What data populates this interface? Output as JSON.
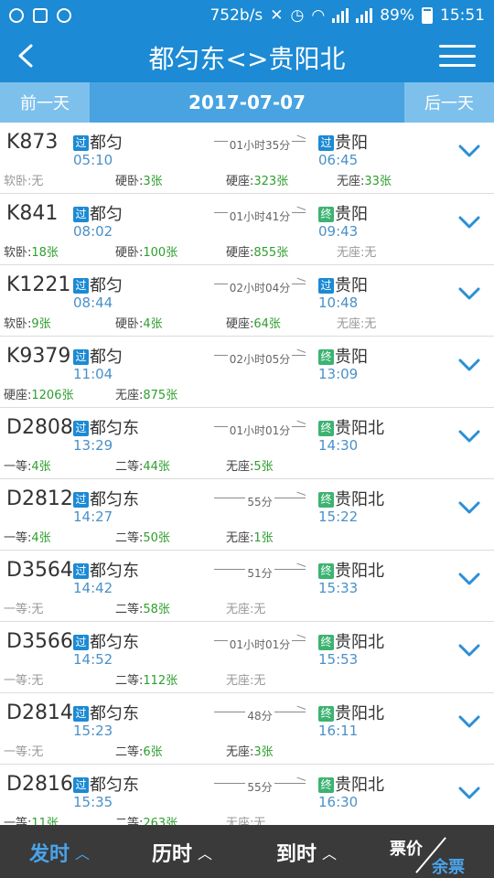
{
  "status_bar": {
    "network_speed": "752b/s",
    "battery": "89%",
    "time": "15:51"
  },
  "header": {
    "title": "都匀东<>贵阳北"
  },
  "date_bar": {
    "prev_label": "前一天",
    "date": "2017-07-07",
    "next_label": "后一天"
  },
  "trains": [
    {
      "no": "K873",
      "from_badge": "过",
      "from": "都匀",
      "depart": "05:10",
      "duration": "01小时35分",
      "to_badge": "过",
      "to": "贵阳",
      "arrive": "06:45",
      "seats": [
        {
          "label": "软卧:",
          "count": "无"
        },
        {
          "label": "硬卧:",
          "count": "3张"
        },
        {
          "label": "硬座:",
          "count": "323张"
        },
        {
          "label": "无座:",
          "count": "33张"
        }
      ]
    },
    {
      "no": "K841",
      "from_badge": "过",
      "from": "都匀",
      "depart": "08:02",
      "duration": "01小时41分",
      "to_badge": "终",
      "to": "贵阳",
      "arrive": "09:43",
      "seats": [
        {
          "label": "软卧:",
          "count": "18张"
        },
        {
          "label": "硬卧:",
          "count": "100张"
        },
        {
          "label": "硬座:",
          "count": "855张"
        },
        {
          "label": "无座:",
          "count": "无"
        }
      ]
    },
    {
      "no": "K1221",
      "from_badge": "过",
      "from": "都匀",
      "depart": "08:44",
      "duration": "02小时04分",
      "to_badge": "过",
      "to": "贵阳",
      "arrive": "10:48",
      "seats": [
        {
          "label": "软卧:",
          "count": "9张"
        },
        {
          "label": "硬卧:",
          "count": "4张"
        },
        {
          "label": "硬座:",
          "count": "64张"
        },
        {
          "label": "无座:",
          "count": "无"
        }
      ]
    },
    {
      "no": "K9379",
      "from_badge": "过",
      "from": "都匀",
      "depart": "11:04",
      "duration": "02小时05分",
      "to_badge": "终",
      "to": "贵阳",
      "arrive": "13:09",
      "seats": [
        {
          "label": "硬座:",
          "count": "1206张"
        },
        {
          "label": "无座:",
          "count": "875张"
        }
      ]
    },
    {
      "no": "D2808",
      "from_badge": "过",
      "from": "都匀东",
      "depart": "13:29",
      "duration": "01小时01分",
      "to_badge": "终",
      "to": "贵阳北",
      "arrive": "14:30",
      "seats": [
        {
          "label": "一等:",
          "count": "4张"
        },
        {
          "label": "二等:",
          "count": "44张"
        },
        {
          "label": "无座:",
          "count": "5张"
        }
      ]
    },
    {
      "no": "D2812",
      "from_badge": "过",
      "from": "都匀东",
      "depart": "14:27",
      "duration": "55分",
      "to_badge": "终",
      "to": "贵阳北",
      "arrive": "15:22",
      "seats": [
        {
          "label": "一等:",
          "count": "4张"
        },
        {
          "label": "二等:",
          "count": "50张"
        },
        {
          "label": "无座:",
          "count": "1张"
        }
      ]
    },
    {
      "no": "D3564",
      "from_badge": "过",
      "from": "都匀东",
      "depart": "14:42",
      "duration": "51分",
      "to_badge": "终",
      "to": "贵阳北",
      "arrive": "15:33",
      "seats": [
        {
          "label": "一等:",
          "count": "无"
        },
        {
          "label": "二等:",
          "count": "58张"
        },
        {
          "label": "无座:",
          "count": "无"
        }
      ]
    },
    {
      "no": "D3566",
      "from_badge": "过",
      "from": "都匀东",
      "depart": "14:52",
      "duration": "01小时01分",
      "to_badge": "终",
      "to": "贵阳北",
      "arrive": "15:53",
      "seats": [
        {
          "label": "一等:",
          "count": "无"
        },
        {
          "label": "二等:",
          "count": "112张"
        },
        {
          "label": "无座:",
          "count": "无"
        }
      ]
    },
    {
      "no": "D2814",
      "from_badge": "过",
      "from": "都匀东",
      "depart": "15:23",
      "duration": "48分",
      "to_badge": "终",
      "to": "贵阳北",
      "arrive": "16:11",
      "seats": [
        {
          "label": "一等:",
          "count": "无"
        },
        {
          "label": "二等:",
          "count": "6张"
        },
        {
          "label": "无座:",
          "count": "3张"
        }
      ]
    },
    {
      "no": "D2816",
      "from_badge": "过",
      "from": "都匀东",
      "depart": "15:35",
      "duration": "55分",
      "to_badge": "终",
      "to": "贵阳北",
      "arrive": "16:30",
      "seats": [
        {
          "label": "一等:",
          "count": "11张"
        },
        {
          "label": "二等:",
          "count": "263张"
        },
        {
          "label": "无座:",
          "count": "无"
        }
      ]
    }
  ],
  "bottom_bar": {
    "sort_depart": "发时",
    "sort_duration": "历时",
    "sort_arrive": "到时",
    "price_label": "票价",
    "remaining_label": "余票"
  },
  "colors": {
    "primary": "#1c8ad4",
    "date_bar": "#48a3e0",
    "day_button": "#7ec0ec",
    "pass_badge": "#1c8ad4",
    "terminal_badge": "#3cb371",
    "available_count": "#2e9e2e",
    "bottom_bar": "#3a3a3a",
    "active_sort": "#4aa3e8"
  },
  "icons": {
    "back": "back-arrow-icon",
    "menu": "menu-icon",
    "expand": "chevron-down-icon",
    "sort_caret": "chevron-up-icon"
  }
}
